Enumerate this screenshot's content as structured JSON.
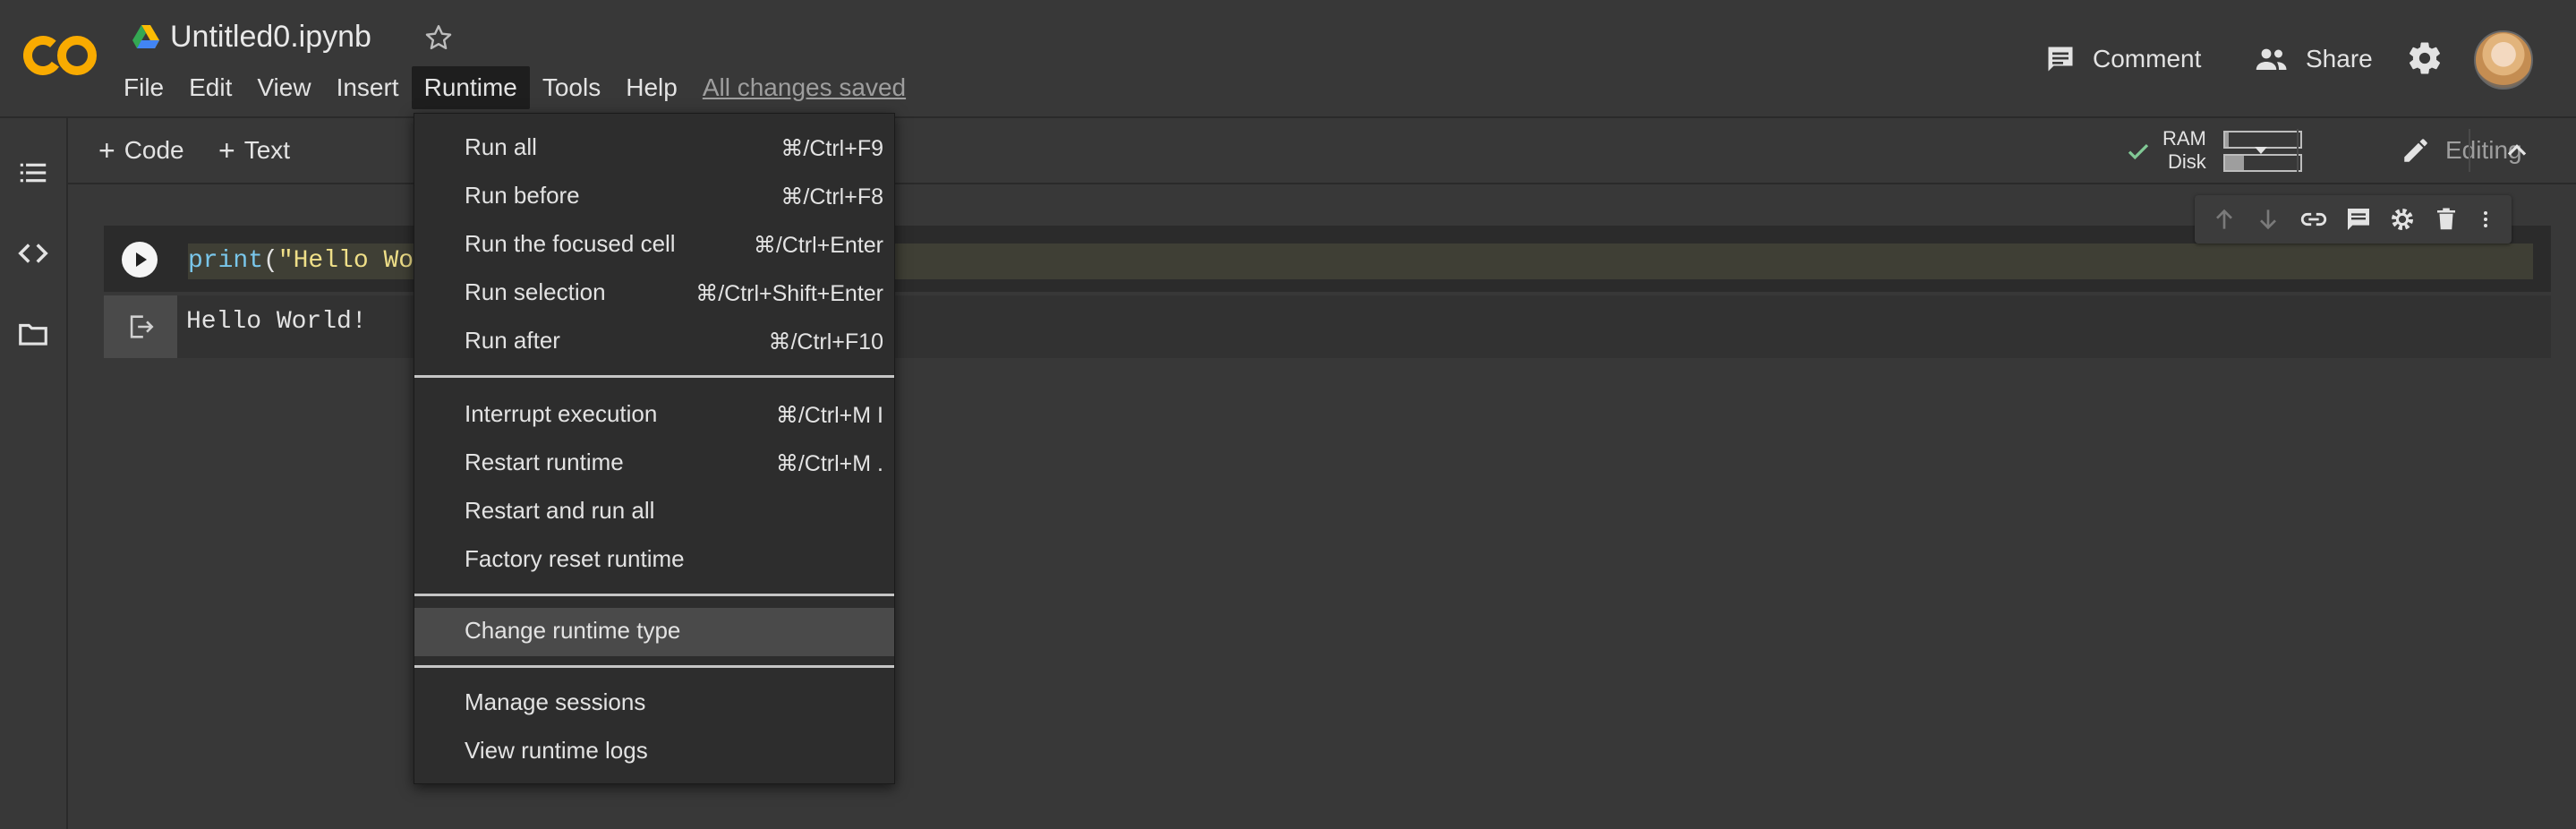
{
  "header": {
    "title": "Untitled0.ipynb",
    "menus": [
      "File",
      "Edit",
      "View",
      "Insert",
      "Runtime",
      "Tools",
      "Help"
    ],
    "active_menu": "Runtime",
    "save_status": "All changes saved",
    "comment_label": "Comment",
    "share_label": "Share"
  },
  "toolbar": {
    "add_code": "Code",
    "add_text": "Text",
    "ram_label": "RAM",
    "disk_label": "Disk",
    "ram_usage": 0.05,
    "disk_usage": 0.25,
    "editing_label": "Editing"
  },
  "cell": {
    "code_fn": "print",
    "code_open": "(",
    "code_str": "\"Hello Wo",
    "output": "Hello World!"
  },
  "runtime_menu": {
    "items": [
      {
        "label": "Run all",
        "shortcut": "⌘/Ctrl+F9"
      },
      {
        "label": "Run before",
        "shortcut": "⌘/Ctrl+F8"
      },
      {
        "label": "Run the focused cell",
        "shortcut": "⌘/Ctrl+Enter"
      },
      {
        "label": "Run selection",
        "shortcut": "⌘/Ctrl+Shift+Enter"
      },
      {
        "label": "Run after",
        "shortcut": "⌘/Ctrl+F10"
      },
      {
        "label": "Interrupt execution",
        "shortcut": "⌘/Ctrl+M I"
      },
      {
        "label": "Restart runtime",
        "shortcut": "⌘/Ctrl+M ."
      },
      {
        "label": "Restart and run all",
        "shortcut": ""
      },
      {
        "label": "Factory reset runtime",
        "shortcut": ""
      },
      {
        "label": "Change runtime type",
        "shortcut": ""
      },
      {
        "label": "Manage sessions",
        "shortcut": ""
      },
      {
        "label": "View runtime logs",
        "shortcut": ""
      }
    ],
    "highlighted": "Change runtime type"
  },
  "colors": {
    "background": "#383838",
    "logo_orange": "#F9AB00",
    "accent_green": "#81C995",
    "code_function": "#79C6EA",
    "code_string": "#EFDF88"
  }
}
